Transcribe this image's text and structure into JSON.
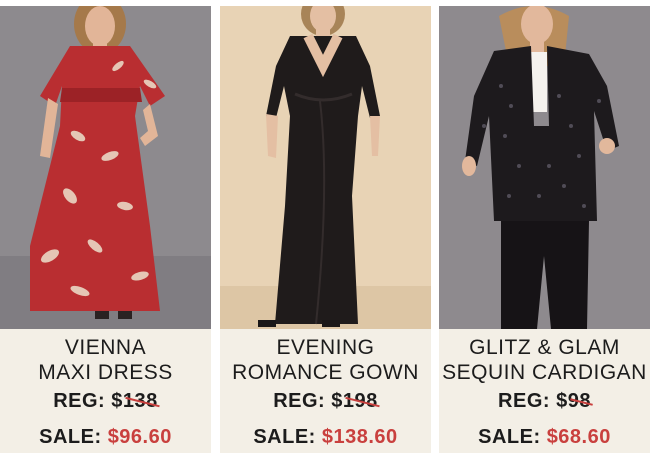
{
  "products": [
    {
      "name_line1": "VIENNA",
      "name_line2": "MAXI DRESS",
      "reg_label": "REG:",
      "reg_price": "$138",
      "sale_label": "SALE:",
      "sale_price": "$96.60"
    },
    {
      "name_line1": "EVENING",
      "name_line2": "ROMANCE GOWN",
      "reg_label": "REG:",
      "reg_price": "$198",
      "sale_label": "SALE:",
      "sale_price": "$138.60"
    },
    {
      "name_line1": "GLITZ & GLAM",
      "name_line2": "SEQUIN CARDIGAN",
      "reg_label": "REG:",
      "reg_price": "$98",
      "sale_label": "SALE:",
      "sale_price": "$68.60"
    }
  ],
  "colors": {
    "info_background": "#f3efe6",
    "sale_red": "#c9403e",
    "text": "#1c1c1c"
  }
}
